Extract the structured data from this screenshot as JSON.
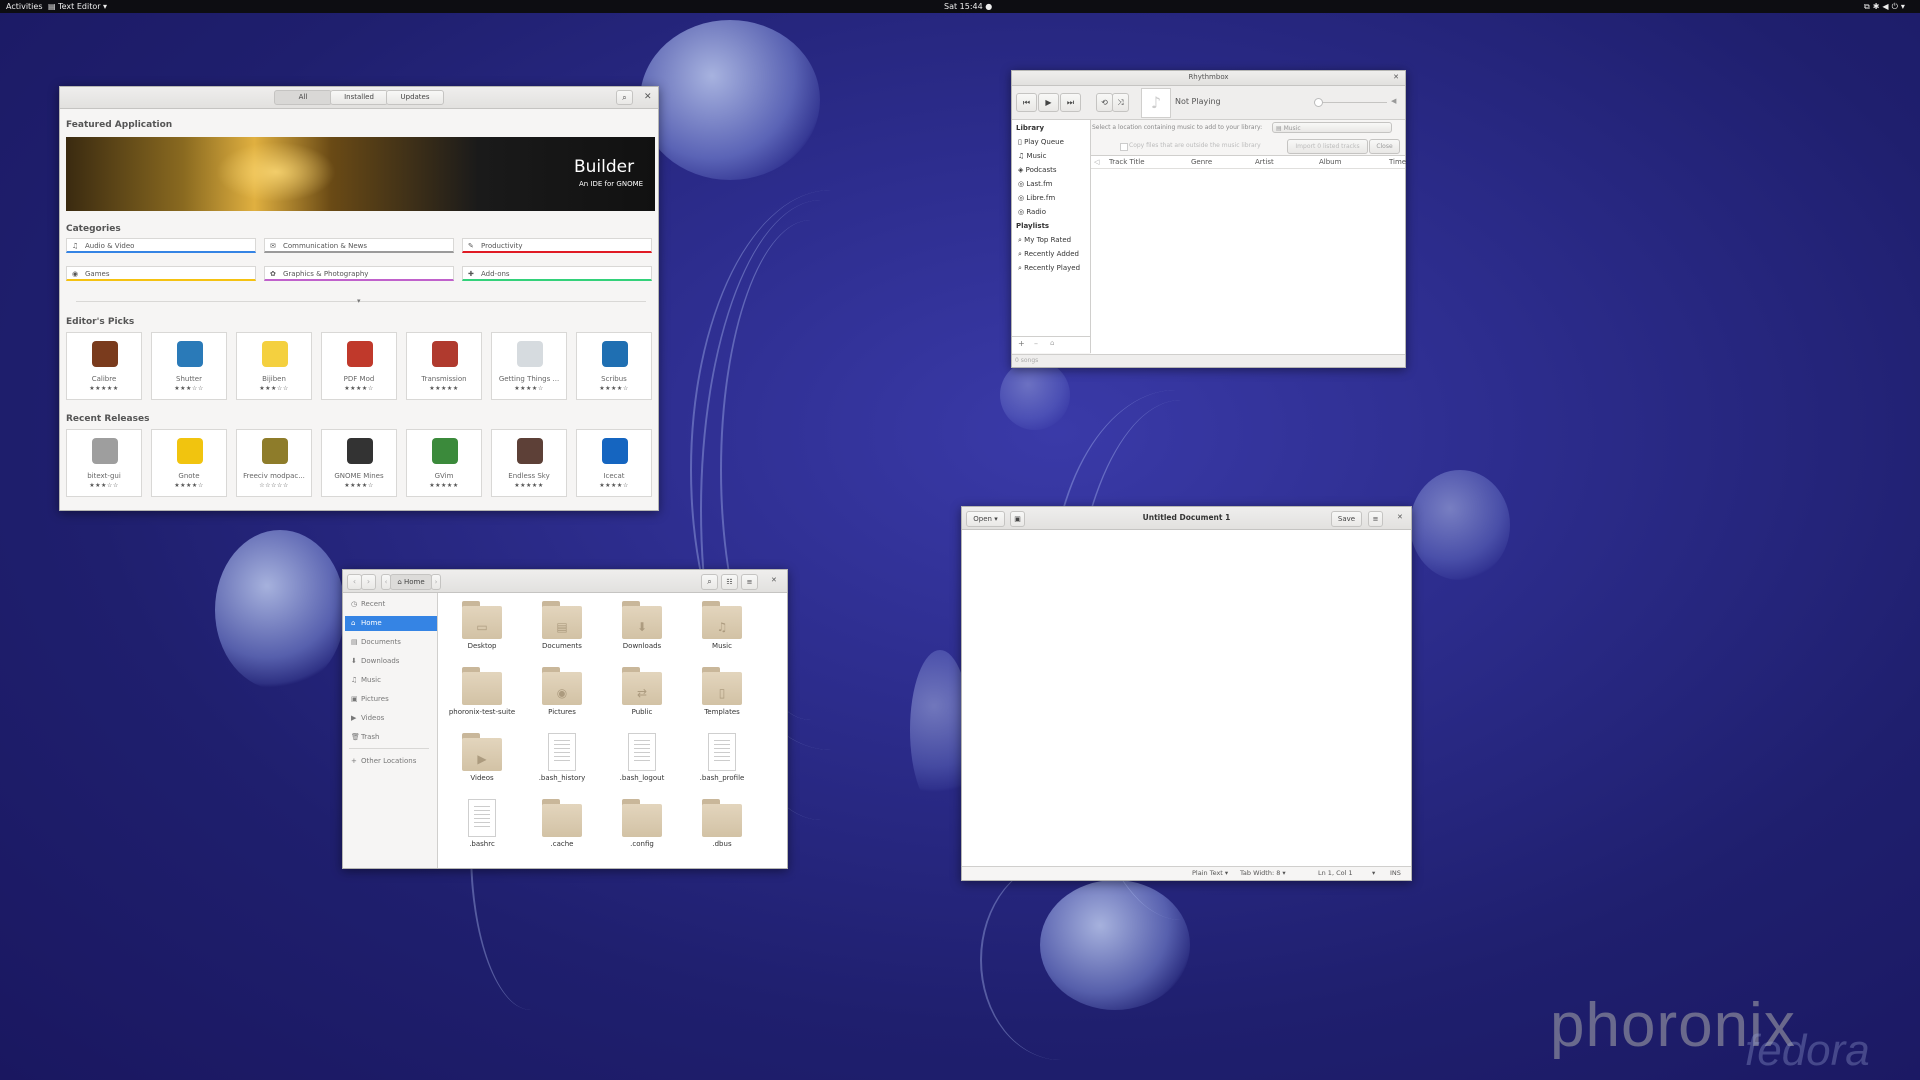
{
  "topbar": {
    "activities": "Activities",
    "app_menu": "Text Editor ▾",
    "clock": "Sat 15:44 ●"
  },
  "watermark": {
    "brand": "phoronix",
    "sub": "fedora"
  },
  "software": {
    "tabs": [
      "All",
      "Installed",
      "Updates"
    ],
    "featured_heading": "Featured Application",
    "banner_title": "Builder",
    "banner_sub": "An IDE for GNOME",
    "categories_heading": "Categories",
    "categories": [
      {
        "label": "Audio & Video",
        "icon": "♫",
        "color": "#3584e4"
      },
      {
        "label": "Communication & News",
        "icon": "✉",
        "color": "#9a9a9a"
      },
      {
        "label": "Productivity",
        "icon": "✎",
        "color": "#e01b24"
      },
      {
        "label": "Games",
        "icon": "◉",
        "color": "#f5c211"
      },
      {
        "label": "Graphics & Photography",
        "icon": "✿",
        "color": "#c061cb"
      },
      {
        "label": "Add-ons",
        "icon": "✚",
        "color": "#33d17a"
      }
    ],
    "editors_heading": "Editor's Picks",
    "editors": [
      {
        "name": "Calibre",
        "stars": "★★★★★",
        "color": "#7a3b1d"
      },
      {
        "name": "Shutter",
        "stars": "★★★☆☆",
        "color": "#2a7ab8"
      },
      {
        "name": "Bijiben",
        "stars": "★★★☆☆",
        "color": "#f4d03f"
      },
      {
        "name": "PDF Mod",
        "stars": "★★★★☆",
        "color": "#c0392b"
      },
      {
        "name": "Transmission",
        "stars": "★★★★★",
        "color": "#b03a2e"
      },
      {
        "name": "Getting Things ...",
        "stars": "★★★★☆",
        "color": "#d6dbdf"
      },
      {
        "name": "Scribus",
        "stars": "★★★★☆",
        "color": "#1f6fb2"
      }
    ],
    "recent_heading": "Recent Releases",
    "recent": [
      {
        "name": "bitext-gui",
        "stars": "★★★☆☆",
        "color": "#9e9e9e"
      },
      {
        "name": "Gnote",
        "stars": "★★★★☆",
        "color": "#f1c40f"
      },
      {
        "name": "Freeciv modpac...",
        "stars": "☆☆☆☆☆",
        "color": "#8e7c2a"
      },
      {
        "name": "GNOME Mines",
        "stars": "★★★★☆",
        "color": "#333333"
      },
      {
        "name": "GVim",
        "stars": "★★★★★",
        "color": "#3b8a3b"
      },
      {
        "name": "Endless Sky",
        "stars": "★★★★★",
        "color": "#5d4037"
      },
      {
        "name": "Icecat",
        "stars": "★★★★☆",
        "color": "#1565c0"
      }
    ]
  },
  "rhythmbox": {
    "title": "Rhythmbox",
    "now_playing": "Not Playing",
    "library_heading": "Library",
    "library": [
      "Play Queue",
      "Music",
      "Podcasts",
      "Last.fm",
      "Libre.fm",
      "Radio"
    ],
    "playlists_heading": "Playlists",
    "playlists": [
      "My Top Rated",
      "Recently Added",
      "Recently Played"
    ],
    "location_prompt": "Select a location containing music to add to your library:",
    "location_value": "Music",
    "copy_files": "Copy files that are outside the music library",
    "import_button": "Import 0 listed tracks",
    "close_button": "Close",
    "columns": [
      "Track Title",
      "Genre",
      "Artist",
      "Album",
      "Time"
    ],
    "status": "0 songs"
  },
  "gedit": {
    "open_label": "Open",
    "title": "Untitled Document 1",
    "save_label": "Save",
    "status_syntax": "Plain Text ▾",
    "status_tab": "Tab Width: 8 ▾",
    "status_pos": "Ln 1, Col 1",
    "status_ins": "INS"
  },
  "files": {
    "path": "Home",
    "sidebar": [
      {
        "label": "Recent",
        "icon": "◷"
      },
      {
        "label": "Home",
        "icon": "⌂"
      },
      {
        "label": "Documents",
        "icon": "▤"
      },
      {
        "label": "Downloads",
        "icon": "⬇"
      },
      {
        "label": "Music",
        "icon": "♫"
      },
      {
        "label": "Pictures",
        "icon": "▣"
      },
      {
        "label": "Videos",
        "icon": "▶"
      },
      {
        "label": "Trash",
        "icon": "🗑"
      },
      {
        "label": "Other Locations",
        "icon": "+"
      }
    ],
    "items": [
      {
        "name": "Desktop",
        "kind": "folder",
        "emblem": "▭"
      },
      {
        "name": "Documents",
        "kind": "folder",
        "emblem": "▤"
      },
      {
        "name": "Downloads",
        "kind": "folder",
        "emblem": "⬇"
      },
      {
        "name": "Music",
        "kind": "folder",
        "emblem": "♫"
      },
      {
        "name": "phoronix-test-suite",
        "kind": "folder",
        "emblem": ""
      },
      {
        "name": "Pictures",
        "kind": "folder",
        "emblem": "◉"
      },
      {
        "name": "Public",
        "kind": "folder",
        "emblem": "⇄"
      },
      {
        "name": "Templates",
        "kind": "folder",
        "emblem": "▯"
      },
      {
        "name": "Videos",
        "kind": "folder",
        "emblem": "▶"
      },
      {
        "name": ".bash_history",
        "kind": "file",
        "emblem": ""
      },
      {
        "name": ".bash_logout",
        "kind": "file",
        "emblem": ""
      },
      {
        "name": ".bash_profile",
        "kind": "file",
        "emblem": ""
      },
      {
        "name": ".bashrc",
        "kind": "file",
        "emblem": ""
      },
      {
        "name": ".cache",
        "kind": "folder",
        "emblem": ""
      },
      {
        "name": ".config",
        "kind": "folder",
        "emblem": ""
      },
      {
        "name": ".dbus",
        "kind": "folder",
        "emblem": ""
      }
    ]
  }
}
